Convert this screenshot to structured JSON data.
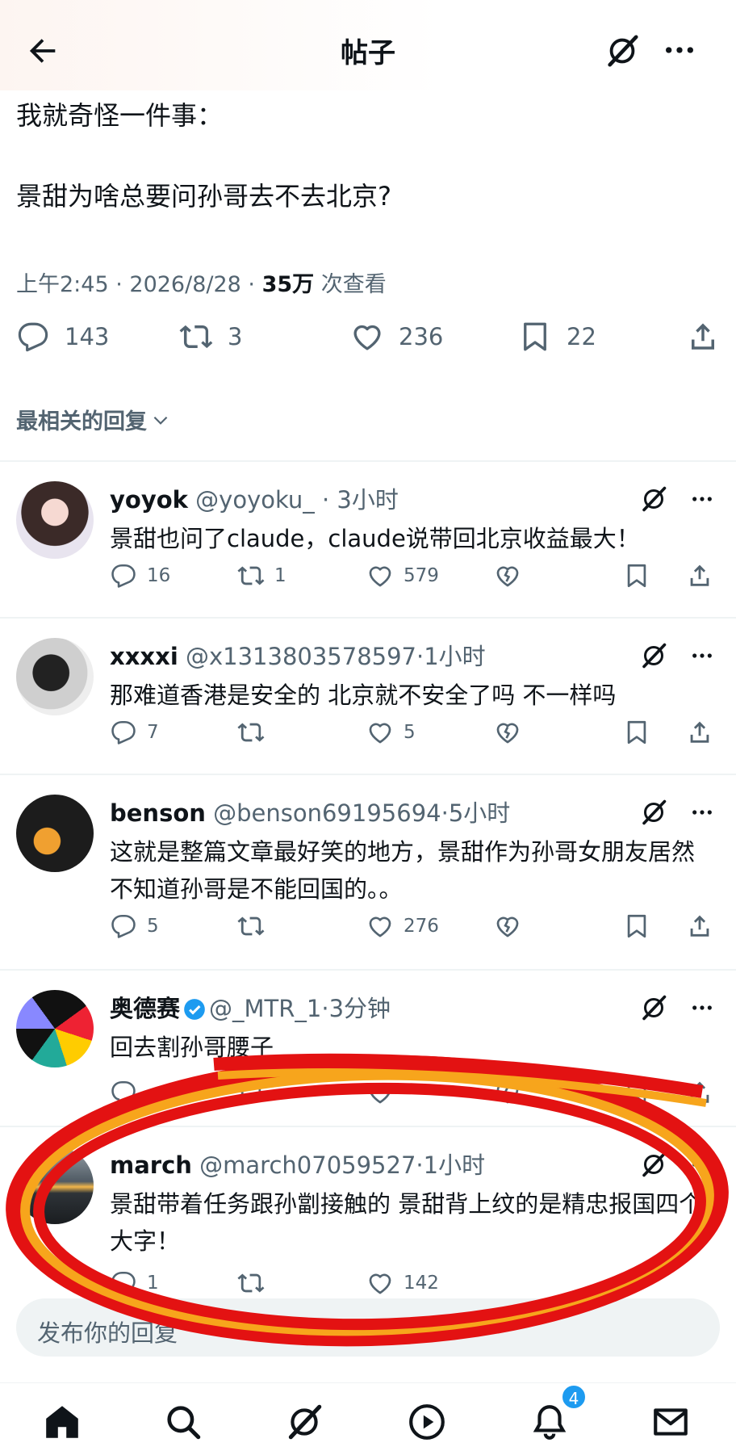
{
  "header": {
    "title": "帖子"
  },
  "post": {
    "text": "我就奇怪一件事：\n\n景甜为啥总要问孙哥去不去北京?",
    "time": "上午2:45",
    "date": "2026/8/28",
    "views_count": "35万",
    "views_label": "次查看",
    "replies": "143",
    "reposts": "3",
    "likes": "236",
    "bookmarks": "22"
  },
  "sort_label": "最相关的回复",
  "replies": [
    {
      "name": "yoyok",
      "handle": "@yoyoku_",
      "time": "3小时",
      "text": "景甜也问了claude，claude说带回北京收益最大！",
      "replies": "16",
      "reposts": "1",
      "likes": "579"
    },
    {
      "name": "xxxxi",
      "handle": "@x1313803578597",
      "time": "1小时",
      "text": "那难道香港是安全的 北京就不安全了吗 不一样吗",
      "replies": "7",
      "reposts": "",
      "likes": "5"
    },
    {
      "name": "benson",
      "handle": "@benson69195694",
      "time": "5小时",
      "text": "这就是整篇文章最好笑的地方，景甜作为孙哥女朋友居然不知道孙哥是不能回国的。。",
      "replies": "5",
      "reposts": "",
      "likes": "276"
    },
    {
      "name": "奥德赛",
      "verified": true,
      "handle": "@_MTR_1",
      "time": "3分钟",
      "text": "回去割孙哥腰子",
      "replies": "",
      "reposts": "",
      "likes": ""
    },
    {
      "name": "march",
      "handle": "@march07059527",
      "time": "1小时",
      "text": "景甜带着任务跟孙劏接触的 景甜背上纹的是精忠报国四个大字！",
      "replies": "1",
      "reposts": "",
      "likes": "142"
    }
  ],
  "compose": {
    "placeholder": "发布你的回复"
  },
  "nav": {
    "notifications_badge": "4"
  },
  "colors": {
    "text": "#0f1419",
    "muted": "#536471",
    "accent": "#1d9bf0",
    "highlight_red": "#e31212",
    "highlight_orange": "#f7a51c"
  },
  "icons": [
    "back-arrow-icon",
    "grok-icon",
    "more-icon",
    "reply-icon",
    "repost-icon",
    "like-icon",
    "bookmark-icon",
    "share-icon",
    "heart-broken-icon",
    "home-icon",
    "search-icon",
    "play-icon",
    "bell-icon",
    "mail-icon"
  ]
}
